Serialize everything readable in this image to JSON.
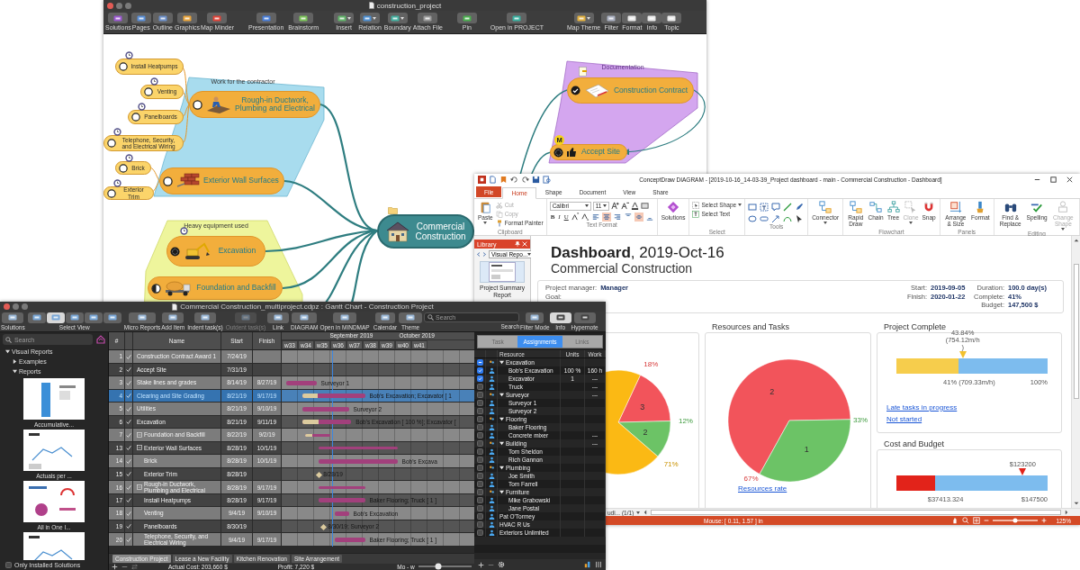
{
  "mindmap_window": {
    "title": "construction_project",
    "toolbar": [
      {
        "label": "Solutions",
        "menu": false
      },
      {
        "label": "Pages",
        "menu": false
      },
      {
        "label": "Outline",
        "menu": false
      },
      {
        "label": "Graphics",
        "menu": false
      },
      {
        "label": "Map Minder",
        "menu": false
      },
      {
        "label": "Presentation",
        "menu": false
      },
      {
        "label": "Brainstorm",
        "menu": false
      },
      {
        "label": "Insert",
        "menu": true
      },
      {
        "label": "Relation",
        "menu": true
      },
      {
        "label": "Boundary",
        "menu": true
      },
      {
        "label": "Attach File",
        "menu": false
      },
      {
        "label": "Pin",
        "menu": false
      },
      {
        "label": "Open in PROJECT",
        "menu": false
      },
      {
        "label": "Map Theme",
        "menu": true
      },
      {
        "label": "Filter",
        "menu": false
      },
      {
        "label": "Format",
        "menu": false
      },
      {
        "label": "Info",
        "menu": false
      },
      {
        "label": "Topic",
        "menu": false
      }
    ]
  },
  "mind_map": {
    "boundaries": [
      {
        "label": "Work for the contractor",
        "color": "#a8dcee"
      },
      {
        "label": "Heavy equipment used",
        "color": "#eef59c"
      },
      {
        "label": "Documentation",
        "color": "#d4a6ef"
      }
    ],
    "central": {
      "text": "Commercial Construction"
    },
    "topics": [
      {
        "text": "Rough-in Ductwork, Plumbing and Electrical",
        "status": {
          "kind": "open"
        },
        "children": [
          {
            "text": "Install Heatpumps",
            "status": {
              "kind": "open"
            }
          },
          {
            "text": "Venting",
            "status": {
              "kind": "open"
            }
          },
          {
            "text": "Panelboards",
            "status": {
              "kind": "open"
            }
          },
          {
            "text": "Telephone, Security, and Electrical Wiring",
            "status": {
              "kind": "open"
            }
          }
        ]
      },
      {
        "text": "Exterior Wall Surfaces",
        "status": {
          "kind": "open"
        },
        "children": [
          {
            "text": "Brick",
            "status": {
              "kind": "open"
            }
          },
          {
            "text": "Exterior Trim",
            "status": {
              "kind": "open"
            }
          }
        ]
      },
      {
        "text": "Excavation",
        "status": {
          "kind": "full"
        }
      },
      {
        "text": "Foundation and Backfill",
        "status": {
          "kind": "half"
        }
      },
      {
        "text": "Construction Contract",
        "status": {
          "kind": "done"
        }
      },
      {
        "text": "Accept Site",
        "status": {
          "kind": "full"
        },
        "badge": "M"
      }
    ]
  },
  "dashboard_window": {
    "title": "ConceptDraw DIAGRAM - [2019-10-16_14-03-39_Project dashboard - main - Commercial Construction - Dashboard]",
    "tabs": [
      {
        "label": "File",
        "kind": "file",
        "selected": false
      },
      {
        "label": "Home",
        "kind": "tab",
        "selected": true
      },
      {
        "label": "Shape",
        "kind": "tab",
        "selected": false
      },
      {
        "label": "Document",
        "kind": "tab",
        "selected": false
      },
      {
        "label": "View",
        "kind": "tab",
        "selected": false
      },
      {
        "label": "Share",
        "kind": "tab",
        "selected": false
      }
    ],
    "ribbon": [
      {
        "kind": "buttons",
        "label": "Clipboard",
        "items": [
          {
            "label": "Paste",
            "kind": "large",
            "disabled": false,
            "menu": true
          },
          {
            "label": "Cut",
            "kind": "small",
            "disabled": true,
            "menu": false
          },
          {
            "label": "Copy",
            "kind": "small",
            "disabled": true,
            "menu": false
          },
          {
            "label": "Format Painter",
            "kind": "small",
            "disabled": false,
            "menu": false
          }
        ]
      },
      {
        "kind": "text_format",
        "label": "Text Format",
        "font": "Calibri",
        "size": "11",
        "styles": [
          "B",
          "I",
          "U"
        ],
        "align": [
          {
            "selected": false
          },
          {
            "selected": true
          },
          {
            "selected": false
          }
        ],
        "valign": [
          {
            "selected": false
          },
          {
            "selected": true
          },
          {
            "selected": false
          }
        ]
      },
      {
        "kind": "buttons",
        "items": [
          {
            "label": "Solutions",
            "kind": "large",
            "disabled": false,
            "menu": false
          }
        ]
      },
      {
        "kind": "buttons",
        "label": "Select",
        "items": [
          {
            "label": "Select Shape",
            "kind": "small",
            "disabled": false,
            "menu": true
          },
          {
            "label": "Select Text",
            "kind": "small",
            "disabled": false,
            "menu": false
          }
        ]
      },
      {
        "kind": "tools",
        "label": "Tools"
      },
      {
        "kind": "buttons",
        "items": [
          {
            "label": "Connector",
            "kind": "large",
            "disabled": false,
            "menu": true
          }
        ]
      },
      {
        "kind": "buttons",
        "label": "Flowchart",
        "items": [
          {
            "label": "Rapid Draw",
            "kind": "large",
            "disabled": false,
            "menu": false
          },
          {
            "label": "Chain",
            "kind": "large",
            "disabled": false,
            "menu": false
          },
          {
            "label": "Tree",
            "kind": "large",
            "disabled": false,
            "menu": false
          },
          {
            "label": "Clone",
            "kind": "large",
            "disabled": true,
            "menu": true
          },
          {
            "label": "Snap",
            "kind": "large",
            "disabled": false,
            "menu": false
          }
        ]
      },
      {
        "kind": "buttons",
        "label": "Panels",
        "items": [
          {
            "label": "Arrange & Size",
            "kind": "large",
            "disabled": false,
            "menu": false
          },
          {
            "label": "Format",
            "kind": "large",
            "disabled": false,
            "menu": false
          }
        ]
      },
      {
        "kind": "buttons",
        "label": "Editing",
        "items": [
          {
            "label": "Find & Replace",
            "kind": "large",
            "disabled": false,
            "menu": false
          },
          {
            "label": "Spelling",
            "kind": "large",
            "disabled": false,
            "menu": false
          },
          {
            "label": "Change Shape",
            "kind": "large",
            "disabled": true,
            "menu": true
          }
        ]
      }
    ],
    "library": {
      "title": "Library",
      "dropdown": "Visual Repo...",
      "item": "Project Summary Report"
    },
    "heading": "**Dashboard**, 2019-Oct-16",
    "subheading": "Commercial Construction",
    "info_columns": [
      [
        {
          "label": "Project manager:",
          "value": "Manager"
        },
        {
          "label": "Goal:"
        }
      ],
      [
        {
          "label": "Start:",
          "value": "2019-09-05"
        },
        {
          "label": "Finish:",
          "value": "2020-01-22"
        }
      ],
      [
        {
          "label": "Duration:",
          "value": "100.0 day(s)"
        },
        {
          "label": "Complete:",
          "value": "41%"
        },
        {
          "label": "Budget:",
          "value": "147,500 $"
        }
      ]
    ],
    "panels": [
      {
        "kind": "pie",
        "percent_labels": [
          "18%",
          "12%",
          "71%"
        ],
        "chart_data": {
          "type": "pie",
          "values": [
            3,
            2,
            12
          ],
          "value_labels": [
            "3",
            "2",
            null
          ]
        }
      },
      {
        "kind": "pie",
        "title": "Resources and Tasks",
        "link": "Resources rate",
        "percent_labels": [
          "67%",
          "33%"
        ],
        "chart_data": {
          "type": "pie",
          "values": [
            2,
            1
          ],
          "value_labels": [
            "2",
            "1"
          ]
        }
      },
      {
        "kind": "stack",
        "sections": [
          {
            "title": "Project Complete",
            "bar": {
              "level": 0.41,
              "color": "#f6cd4c"
            },
            "marker": {
              "level": 0.4384,
              "color": "#f2c12e",
              "label": "43.84% (754.12m/h )"
            },
            "scale_labels": [
              "41% (709.33m/h)",
              "100%"
            ],
            "links": [
              "Late tasks in progress",
              "Not started"
            ]
          },
          {
            "title": "Cost and Budget",
            "bar": {
              "level": 0.2536,
              "color": "#e2231a"
            },
            "marker": {
              "level": 0.8353,
              "color": "#e2231a",
              "label": "$123200"
            },
            "scale_labels": [
              "$37413.324",
              "$147500"
            ]
          }
        ]
      }
    ],
    "page_nav": "udi... (1/1)",
    "status": {
      "mouse": "Mouse: [ 0.11, 1.57 ] in",
      "zoom": "125%",
      "zoom_slider": {
        "level": 0.5
      }
    }
  },
  "gantt_window": {
    "title": "Commercial Construction_multiproject.cdpz : Gantt Chart - Construction Project",
    "toolbar": [
      {
        "kind": "button",
        "label": "Solutions",
        "disabled": false
      },
      {
        "kind": "views",
        "label": "Select View",
        "views": [
          {
            "selected": false
          },
          {
            "selected": true
          },
          {
            "selected": false
          },
          {
            "selected": false
          },
          {
            "selected": false
          }
        ]
      },
      {
        "kind": "button",
        "label": "Micro Reports",
        "disabled": false
      },
      {
        "kind": "button",
        "label": "Add Item",
        "disabled": false
      },
      {
        "kind": "button",
        "label": "Indent task(s)",
        "disabled": false
      },
      {
        "kind": "button",
        "label": "Outdent task(s)",
        "disabled": true
      },
      {
        "kind": "button",
        "label": "Link",
        "disabled": false
      },
      {
        "kind": "button",
        "label": "DIAGRAM",
        "disabled": false
      },
      {
        "kind": "button",
        "label": "Open in MINDMAP",
        "disabled": false
      },
      {
        "kind": "button",
        "label": "Calendar",
        "disabled": false
      },
      {
        "kind": "button",
        "label": "Theme",
        "disabled": false
      },
      {
        "kind": "search",
        "label": "Search",
        "placeholder": "Search"
      },
      {
        "kind": "button",
        "label": "Filter Mode",
        "disabled": false
      },
      {
        "kind": "toggle",
        "label": "Info",
        "selected": true
      },
      {
        "kind": "toggle",
        "label": "Hypernote",
        "selected": false
      }
    ],
    "sidebar": {
      "search_placeholder": "Search",
      "tree": [
        {
          "label": "Visual Reports",
          "expanded": true,
          "children": [
            {
              "label": "Examples",
              "expanded": false
            },
            {
              "label": "Reports",
              "expanded": true
            }
          ]
        }
      ],
      "reports": [
        {
          "kind": "bar",
          "caption": "Accumulative..."
        },
        {
          "kind": "line",
          "caption": "Actuals per ..."
        },
        {
          "kind": "dashboard",
          "caption": "All in One I..."
        },
        {
          "kind": "line"
        }
      ],
      "only_installed": {
        "label": "Only Installed Solutions",
        "checked": false
      }
    },
    "table": {
      "columns": [
        "#",
        "Name",
        "Start",
        "Finish"
      ],
      "months": [
        "September 2019",
        "October 2019"
      ],
      "weeks": [
        "w33",
        "w34",
        "w35",
        "w36",
        "w37",
        "w38",
        "w39",
        "w40",
        "w41"
      ],
      "tasks": [
        {
          "id": "1",
          "name": "Construction Contract Award 1",
          "start": "7/24/19",
          "kind": "task",
          "selected": false
        },
        {
          "id": "2",
          "name": "Accept Site",
          "start": "7/31/19",
          "kind": "task",
          "selected": false
        },
        {
          "id": "3",
          "name": "Stake lines and grades",
          "start": "8/14/19",
          "finish": "8/27/19",
          "kind": "task",
          "selected": false,
          "bar_label": "Surveyor 1"
        },
        {
          "id": "4",
          "name": "Clearing and Site Grading",
          "start": "8/21/19",
          "finish": "9/17/19",
          "kind": "task",
          "selected": true,
          "level": 0.25,
          "bar_label": "Bob's Excavation; Excavator [ 1"
        },
        {
          "id": "5",
          "name": "Utilities",
          "start": "8/21/19",
          "finish": "9/10/19",
          "kind": "task",
          "selected": false,
          "bar_label": "Surveyor 2"
        },
        {
          "id": "6",
          "name": "Excavation",
          "start": "8/21/19",
          "finish": "9/11/19",
          "kind": "task",
          "selected": false,
          "level": 0.33,
          "bar_label": "Bob's Excavation [ 100 %]; Excavator ["
        },
        {
          "id": "7",
          "name": "Foundation and Backfill",
          "start": "8/22/19",
          "finish": "9/2/19",
          "kind": "summary",
          "expanded": true,
          "selected": false,
          "level": 0.3
        },
        {
          "id": "13",
          "name": "Exterior Wall Surfaces",
          "start": "8/28/19",
          "finish": "10/1/19",
          "kind": "summary",
          "expanded": true,
          "selected": false,
          "children": [
            {
              "id": "14",
              "name": "Brick",
              "start": "8/28/19",
              "finish": "10/1/19",
              "kind": "task",
              "selected": false,
              "bar_label": "Bob's Excava"
            },
            {
              "id": "15",
              "name": "Exterior Trim",
              "start": "8/28/19",
              "kind": "milestone",
              "selected": false,
              "bar_label": "8/28/19"
            }
          ]
        },
        {
          "id": "16",
          "name": "Rough-in Ductwork, Plumbing and Electrical",
          "start": "8/28/19",
          "finish": "9/17/19",
          "kind": "summary",
          "expanded": true,
          "selected": false,
          "children": [
            {
              "id": "17",
              "name": "Install Heatpumps",
              "start": "8/28/19",
              "finish": "9/17/19",
              "kind": "task",
              "selected": false,
              "bar_label": "Baker Flooring; Truck [ 1 ]"
            },
            {
              "id": "18",
              "name": "Venting",
              "start": "9/4/19",
              "finish": "9/10/19",
              "kind": "task",
              "selected": false,
              "bar_label": "Bob's Excavation"
            },
            {
              "id": "19",
              "name": "Panelboards",
              "start": "8/30/19",
              "kind": "milestone",
              "selected": false,
              "bar_label": "8/30/19; Surveyor 2"
            },
            {
              "id": "20",
              "name": "Telephone, Security, and Electrical Wiring",
              "start": "9/4/19",
              "finish": "9/17/19",
              "kind": "task",
              "selected": false,
              "bar_label": "Baker Flooring; Truck [ 1 ]"
            }
          ]
        }
      ]
    },
    "project_tabs": [
      {
        "label": "Construction Project",
        "selected": true
      },
      {
        "label": "Lease a New Facility",
        "selected": false
      },
      {
        "label": "Kitchen Renovation",
        "selected": false
      },
      {
        "label": "Site Arrangement",
        "selected": false
      }
    ],
    "status": {
      "actual_cost": "Actual Cost: 203,660 $",
      "profit": "Profit: 7,220 $",
      "scale": "Mo - w",
      "scale_slider": {
        "level": 0.37
      }
    },
    "assignments": {
      "tabs": [
        {
          "label": "Task",
          "selected": false
        },
        {
          "label": "Assignments",
          "selected": true
        },
        {
          "label": "Links",
          "selected": false
        }
      ],
      "columns": [
        "Resource",
        "Units",
        "Work"
      ],
      "resources": [
        {
          "name": "Excavation",
          "checked": true,
          "mixed": true,
          "expanded": true,
          "children": [
            {
              "name": "Bob's Excavation",
              "units": "100 %",
              "work": "160 h",
              "checked": true,
              "mixed": false
            },
            {
              "name": "Excavator",
              "units": "1",
              "work": "---",
              "checked": true,
              "mixed": false
            },
            {
              "name": "Truck",
              "work": "---",
              "checked": false,
              "mixed": false
            }
          ]
        },
        {
          "name": "Surveyor",
          "work": "---",
          "checked": false,
          "mixed": false,
          "expanded": true,
          "children": [
            {
              "name": "Surveyor 1",
              "checked": false,
              "mixed": false
            },
            {
              "name": "Surveyor 2",
              "checked": false,
              "mixed": false
            }
          ]
        },
        {
          "name": "Flooring",
          "checked": false,
          "mixed": false,
          "expanded": true,
          "children": [
            {
              "name": "Baker Flooring",
              "checked": false,
              "mixed": false
            },
            {
              "name": "Concrete mixer",
              "work": "---",
              "checked": false,
              "mixed": false
            }
          ]
        },
        {
          "name": "Building",
          "work": "---",
          "checked": false,
          "mixed": false,
          "expanded": true,
          "children": [
            {
              "name": "Tom Sheldon",
              "checked": false,
              "mixed": false
            },
            {
              "name": "Rich Gannon",
              "checked": false,
              "mixed": false
            }
          ]
        },
        {
          "name": "Plumbing",
          "checked": false,
          "mixed": false,
          "expanded": true,
          "children": [
            {
              "name": "Joe Smith",
              "checked": false,
              "mixed": false
            },
            {
              "name": "Tom Farrell",
              "checked": false,
              "mixed": false
            }
          ]
        },
        {
          "name": "Furniture",
          "checked": false,
          "mixed": false,
          "expanded": true,
          "children": [
            {
              "name": "Mike Grabowski",
              "checked": false,
              "mixed": false
            },
            {
              "name": "Jane Postal",
              "checked": false,
              "mixed": false
            }
          ]
        },
        {
          "name": "Pat O'Tormey",
          "checked": false,
          "mixed": false
        },
        {
          "name": "HVAC R Us",
          "checked": false,
          "mixed": false
        },
        {
          "name": "Exteriors Unlimited",
          "checked": false,
          "mixed": false
        }
      ]
    }
  }
}
